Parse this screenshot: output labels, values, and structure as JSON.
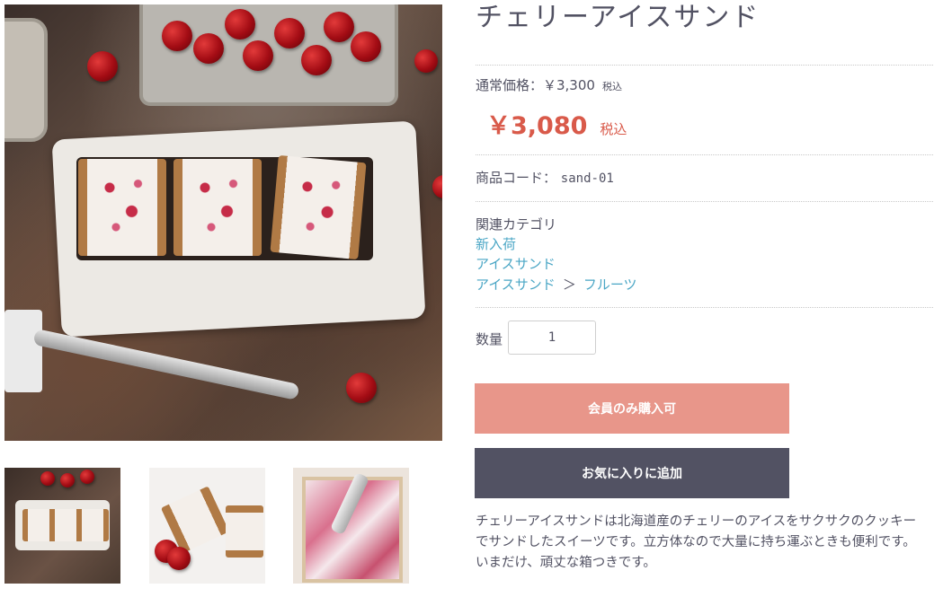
{
  "product": {
    "title": "チェリーアイスサンド",
    "normal_price_label": "通常価格：￥3,300",
    "normal_price_tax": "税込",
    "sale_price": "￥3,080",
    "sale_price_tax": "税込",
    "code_label": "商品コード：",
    "code_value": "sand-01"
  },
  "categories": {
    "label": "関連カテゴリ",
    "links": [
      "新入荷",
      "アイスサンド"
    ],
    "path_parent": "アイスサンド",
    "path_separator": "＞",
    "path_child": "フルーツ"
  },
  "quantity": {
    "label": "数量",
    "value": "1"
  },
  "buttons": {
    "members_only": "会員のみ購入可",
    "add_favorite": "お気に入りに追加"
  },
  "description": {
    "line1": "チェリーアイスサンドは北海道産のチェリーのアイスをサクサクのクッキーでサンドしたスイーツです。立方体なので大量に持ち運ぶときも便利です。",
    "line2": "いまだけ、頑丈な箱つきです。"
  },
  "colors": {
    "sale_price": "#d95a4a",
    "link": "#4aa6c5",
    "members_button": "#e8968a",
    "favorite_button": "#525263"
  }
}
